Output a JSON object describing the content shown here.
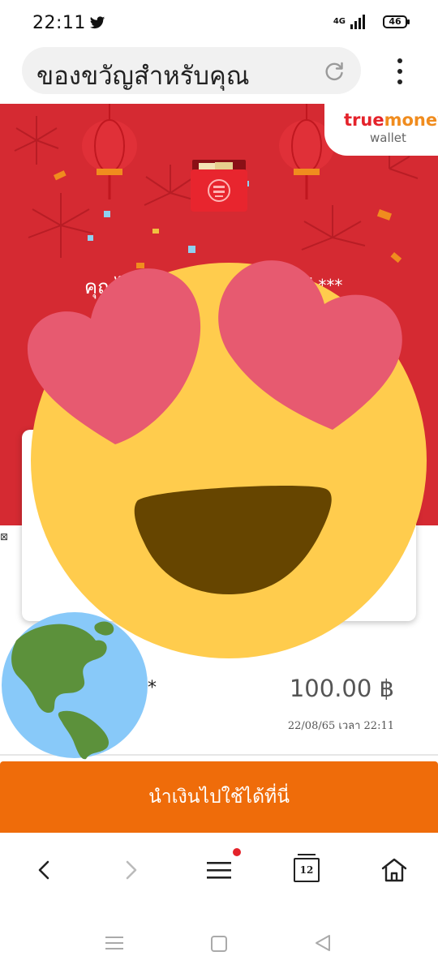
{
  "status_bar": {
    "time": "22:11",
    "network": "4G",
    "battery": "46",
    "icons": [
      "twitter-icon",
      "signal-icon",
      "battery-icon"
    ]
  },
  "browser": {
    "page_title": "ของขวัญสำหรับคุณ",
    "icons": [
      "reload-icon",
      "more-vert-icon"
    ]
  },
  "banner": {
    "brand_true": "true",
    "brand_money": "money",
    "brand_wallet": "wallet",
    "gift_text": "คุณไ",
    "masked_name": "ี ***",
    "background_color": "#d52a32"
  },
  "card": {
    "left_glyph": "⊠"
  },
  "transaction": {
    "sender_masked": "*",
    "amount": "100.00 ฿",
    "date": "22/08/65 เวลา 22:11"
  },
  "cta": {
    "label": "นำเงินไปใช้ได้ที่นี่",
    "color": "#ef6c0a"
  },
  "browser_nav": {
    "tab_count": "12",
    "icons": [
      "back-icon",
      "forward-icon",
      "menu-icon",
      "tabs-icon",
      "home-icon"
    ]
  },
  "system_nav": {
    "icons": [
      "recents-icon",
      "home-square-icon",
      "back-triangle-icon"
    ]
  },
  "overlays": {
    "icons": [
      "heart-eyes-emoji-icon",
      "globe-americas-icon"
    ]
  }
}
